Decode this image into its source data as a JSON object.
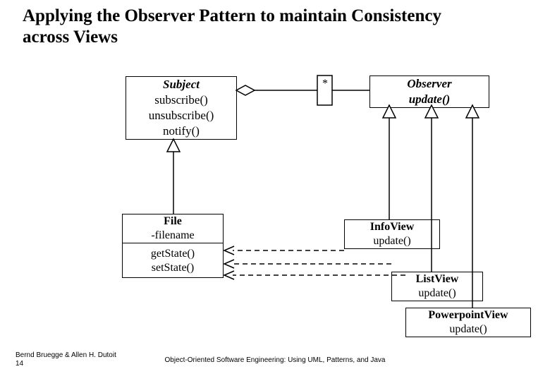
{
  "title": "Applying the Observer Pattern to maintain Consistency across Views",
  "subject": {
    "name": "Subject",
    "m1": "subscribe()",
    "m2": "unsubscribe()",
    "m3": "notify()"
  },
  "observer": {
    "name": "Observer",
    "m1": "update()"
  },
  "file": {
    "name": "File",
    "a1": "-filename",
    "m1": "getState()",
    "m2": "setState()"
  },
  "infoview": {
    "name": "InfoView",
    "m1": "update()"
  },
  "listview": {
    "name": "ListView",
    "m1": "update()"
  },
  "pptview": {
    "name": "PowerpointView",
    "m1": "update()"
  },
  "multiplicity": "*",
  "footer_left": "Bernd Bruegge & Allen H. Dutoit",
  "page_num": "14",
  "footer_center": "Object-Oriented Software Engineering: Using UML, Patterns, and Java"
}
